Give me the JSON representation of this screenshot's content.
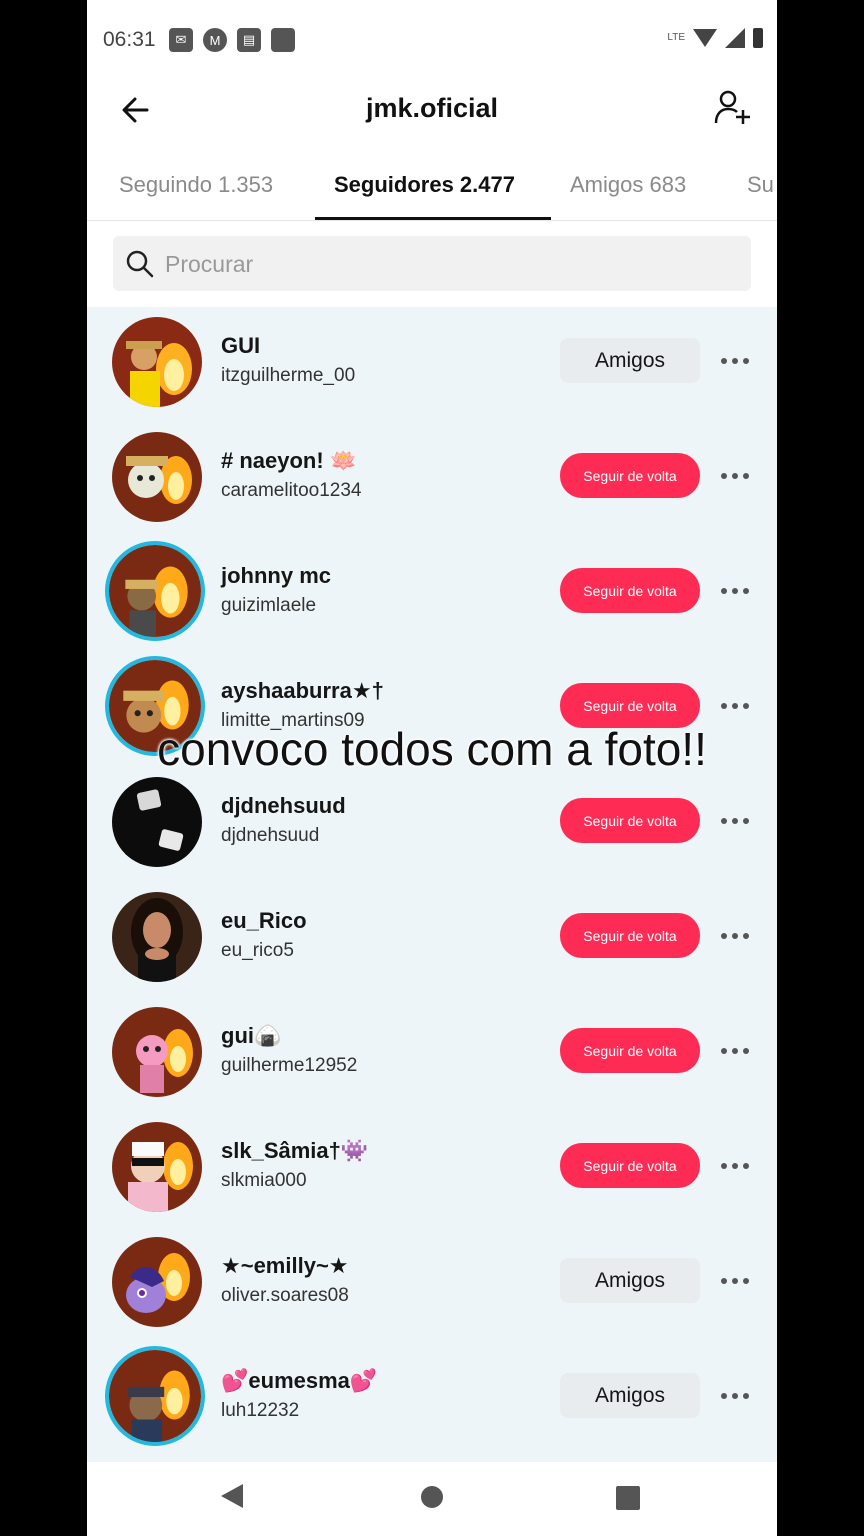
{
  "status": {
    "time": "06:31",
    "lte": "LTE"
  },
  "header": {
    "title": "jmk.oficial"
  },
  "tabs": [
    {
      "label": "Seguindo 1.353"
    },
    {
      "label": "Seguidores 2.477"
    },
    {
      "label": "Amigos 683"
    },
    {
      "label": "Su"
    }
  ],
  "search": {
    "placeholder": "Procurar"
  },
  "followers": [
    {
      "name": "GUI",
      "handle": "itzguilherme_00",
      "action": "Amigos"
    },
    {
      "name": "#  naeyon!  🪷",
      "handle": "caramelitoo1234",
      "action": "Seguir de volta"
    },
    {
      "name": "johnny mc",
      "handle": "guizimlaele",
      "action": "Seguir de volta"
    },
    {
      "name": "ayshaaburra★†",
      "handle": "limitte_martins09",
      "action": "Seguir de volta"
    },
    {
      "name": "djdnehsuud",
      "handle": "djdnehsuud",
      "action": "Seguir de volta"
    },
    {
      "name": "eu_Rico",
      "handle": "eu_rico5",
      "action": "Seguir de volta"
    },
    {
      "name": "gui🍙",
      "handle": "guilherme12952",
      "action": "Seguir de volta"
    },
    {
      "name": "slk_Sâmia†👾",
      "handle": "slkmia000",
      "action": "Seguir de volta"
    },
    {
      "name": "★~emilly~★",
      "handle": "oliver.soares08",
      "action": "Amigos"
    },
    {
      "name": "💕eumesma💕",
      "handle": "luh12232",
      "action": "Amigos"
    }
  ],
  "overlay_caption": "convoco todos com a foto!!",
  "colors": {
    "accent": "#fe2c55",
    "story_ring": "#22b8e0",
    "list_bg": "#eef5f9"
  }
}
